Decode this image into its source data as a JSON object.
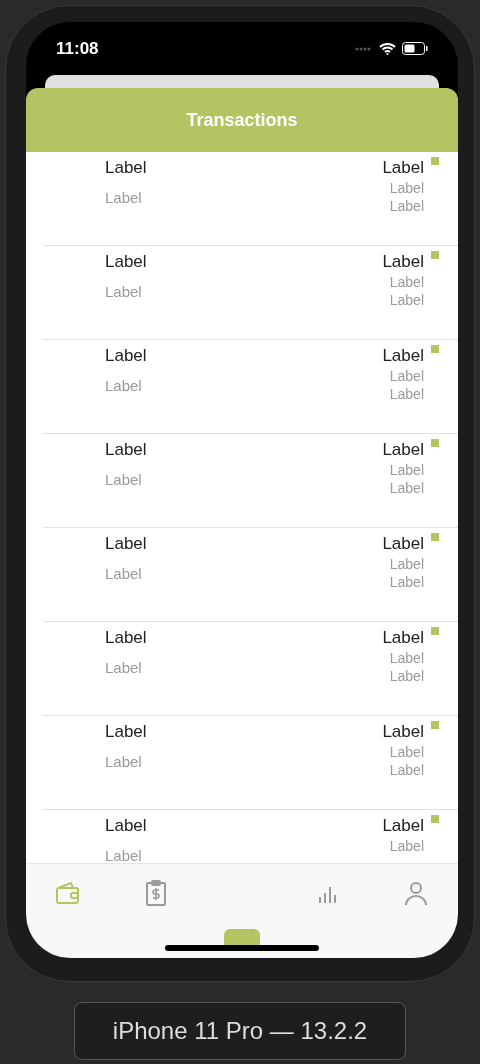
{
  "status_bar": {
    "time": "11:08"
  },
  "header": {
    "title": "Transactions"
  },
  "transactions": [
    {
      "title": "Label",
      "subtitle": "Label",
      "amount": "Label",
      "details": [
        "Label",
        "Label"
      ],
      "color": "#b2c562"
    },
    {
      "title": "Label",
      "subtitle": "Label",
      "amount": "Label",
      "details": [
        "Label",
        "Label"
      ],
      "color": "#b2c562"
    },
    {
      "title": "Label",
      "subtitle": "Label",
      "amount": "Label",
      "details": [
        "Label",
        "Label"
      ],
      "color": "#b2c562"
    },
    {
      "title": "Label",
      "subtitle": "Label",
      "amount": "Label",
      "details": [
        "Label",
        "Label"
      ],
      "color": "#b2c562"
    },
    {
      "title": "Label",
      "subtitle": "Label",
      "amount": "Label",
      "details": [
        "Label",
        "Label"
      ],
      "color": "#b2c562"
    },
    {
      "title": "Label",
      "subtitle": "Label",
      "amount": "Label",
      "details": [
        "Label",
        "Label"
      ],
      "color": "#b2c562"
    },
    {
      "title": "Label",
      "subtitle": "Label",
      "amount": "Label",
      "details": [
        "Label",
        "Label"
      ],
      "color": "#b2c562"
    },
    {
      "title": "Label",
      "subtitle": "Label",
      "amount": "Label",
      "details": [
        "Label"
      ],
      "color": "#b2c562"
    }
  ],
  "tab_bar": [
    {
      "kind": "wallet",
      "selected": true
    },
    {
      "kind": "invoice",
      "selected": false
    },
    {
      "kind": "chart",
      "selected": false
    },
    {
      "kind": "profile",
      "selected": false
    }
  ],
  "device_label": "iPhone 11 Pro — 13.2.2"
}
